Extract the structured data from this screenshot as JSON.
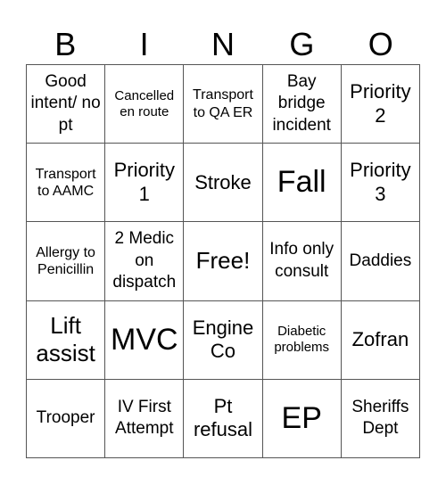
{
  "header": [
    "B",
    "I",
    "N",
    "G",
    "O"
  ],
  "cells": [
    {
      "text": "Good intent/ no pt",
      "size": "fs-m"
    },
    {
      "text": "Cancelled en route",
      "size": "fs-xs"
    },
    {
      "text": "Transport to QA ER",
      "size": "fs-s"
    },
    {
      "text": "Bay bridge incident",
      "size": "fs-m"
    },
    {
      "text": "Priority 2",
      "size": "fs-l"
    },
    {
      "text": "Transport to AAMC",
      "size": "fs-s"
    },
    {
      "text": "Priority 1",
      "size": "fs-l"
    },
    {
      "text": "Stroke",
      "size": "fs-l"
    },
    {
      "text": "Fall",
      "size": "fs-xxl"
    },
    {
      "text": "Priority 3",
      "size": "fs-l"
    },
    {
      "text": "Allergy to Penicillin",
      "size": "fs-s"
    },
    {
      "text": "2 Medic on dispatch",
      "size": "fs-m"
    },
    {
      "text": "Free!",
      "size": "fs-xl"
    },
    {
      "text": "Info only consult",
      "size": "fs-m"
    },
    {
      "text": "Daddies",
      "size": "fs-m"
    },
    {
      "text": "Lift assist",
      "size": "fs-xl"
    },
    {
      "text": "MVC",
      "size": "fs-xxl"
    },
    {
      "text": "Engine Co",
      "size": "fs-l"
    },
    {
      "text": "Diabetic problems",
      "size": "fs-xs"
    },
    {
      "text": "Zofran",
      "size": "fs-l"
    },
    {
      "text": "Trooper",
      "size": "fs-m"
    },
    {
      "text": "IV First Attempt",
      "size": "fs-m"
    },
    {
      "text": "Pt refusal",
      "size": "fs-l"
    },
    {
      "text": "EP",
      "size": "fs-xxl"
    },
    {
      "text": "Sheriffs Dept",
      "size": "fs-m"
    }
  ]
}
